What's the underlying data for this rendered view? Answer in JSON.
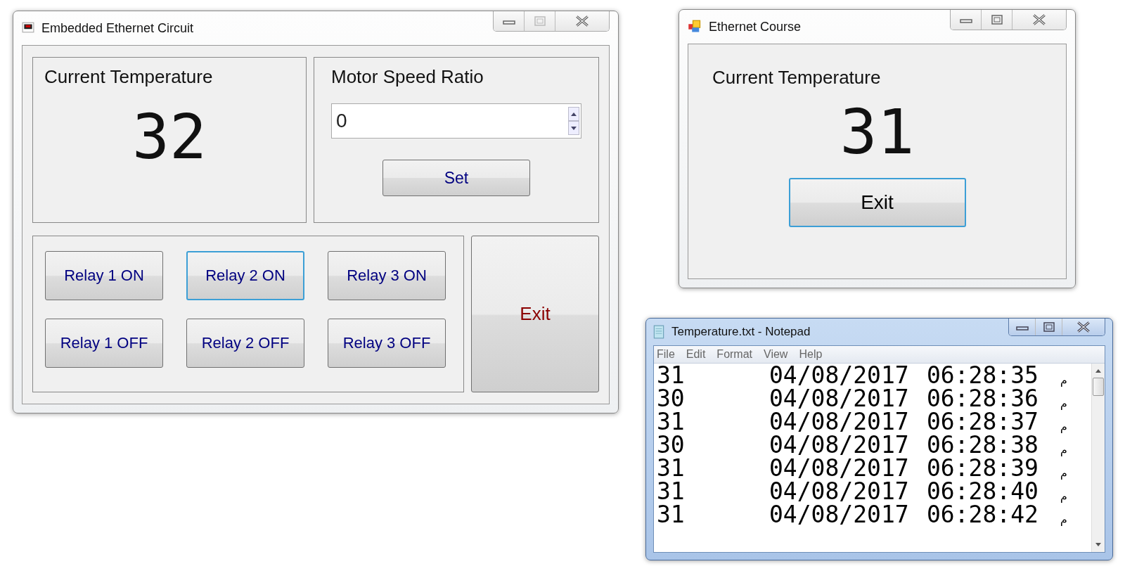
{
  "main_window": {
    "title": "Embedded Ethernet Circuit",
    "temperature_group": {
      "label": "Current Temperature",
      "value": "32"
    },
    "motor_group": {
      "label": "Motor Speed Ratio",
      "spinner_value": "0",
      "set_button": "Set"
    },
    "relay_buttons": [
      {
        "label": "Relay 1 ON",
        "focused": false
      },
      {
        "label": "Relay 2 ON",
        "focused": true
      },
      {
        "label": "Relay 3 ON",
        "focused": false
      },
      {
        "label": "Relay 1 OFF",
        "focused": false
      },
      {
        "label": "Relay 2 OFF",
        "focused": false
      },
      {
        "label": "Relay 3 OFF",
        "focused": false
      }
    ],
    "exit_button": "Exit"
  },
  "course_window": {
    "title": "Ethernet Course",
    "label": "Current Temperature",
    "value": "31",
    "exit_button": "Exit"
  },
  "notepad": {
    "title": "Temperature.txt - Notepad",
    "menu": [
      "File",
      "Edit",
      "Format",
      "View",
      "Help"
    ],
    "lines": [
      {
        "value": "31",
        "date": "04/08/2017",
        "time": "06:28:35",
        "suffix": "م"
      },
      {
        "value": "30",
        "date": "04/08/2017",
        "time": "06:28:36",
        "suffix": "م"
      },
      {
        "value": "31",
        "date": "04/08/2017",
        "time": "06:28:37",
        "suffix": "م"
      },
      {
        "value": "30",
        "date": "04/08/2017",
        "time": "06:28:38",
        "suffix": "م"
      },
      {
        "value": "31",
        "date": "04/08/2017",
        "time": "06:28:39",
        "suffix": "م"
      },
      {
        "value": "31",
        "date": "04/08/2017",
        "time": "06:28:40",
        "suffix": "م"
      },
      {
        "value": "31",
        "date": "04/08/2017",
        "time": "06:28:42",
        "suffix": "م"
      }
    ]
  }
}
